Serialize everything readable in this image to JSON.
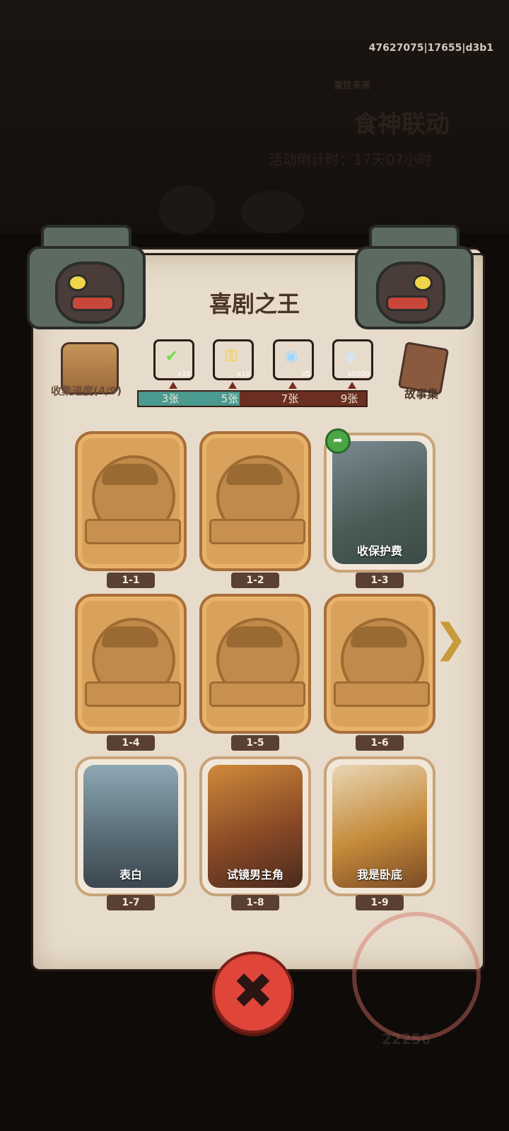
{
  "build_id": "47627075|17655|d3b1",
  "background": {
    "event_subtitle": "魔性来袭",
    "event_title": "食神联动",
    "countdown": "活动倒计时：17天07小时",
    "currency_amount": "22256"
  },
  "panel": {
    "title": "喜剧之王",
    "collect_progress": "收集进度(4/9)",
    "story_label": "故事集",
    "progress": {
      "collected": 4,
      "max": 9
    },
    "rewards": [
      {
        "icon": "checkmark-ticket-icon",
        "qty": "x10",
        "threshold": "3张",
        "color": "#3d86c7"
      },
      {
        "icon": "golden-key-icon",
        "qty": "x10",
        "threshold": "5张",
        "color": "#d7843a"
      },
      {
        "icon": "rainbow-orb-icon",
        "qty": "x5",
        "threshold": "7张",
        "color": "#c73d6a"
      },
      {
        "icon": "crystal-gem-icon",
        "qty": "x5000",
        "threshold": "9张",
        "color": "#8a4ac0"
      }
    ],
    "cards": [
      {
        "id": "1-1",
        "state": "locked",
        "caption": ""
      },
      {
        "id": "1-2",
        "state": "locked",
        "caption": ""
      },
      {
        "id": "1-3",
        "state": "open",
        "caption": "收保护费",
        "share": true
      },
      {
        "id": "1-4",
        "state": "locked",
        "caption": ""
      },
      {
        "id": "1-5",
        "state": "locked",
        "caption": ""
      },
      {
        "id": "1-6",
        "state": "locked",
        "caption": ""
      },
      {
        "id": "1-7",
        "state": "open",
        "caption": "表白"
      },
      {
        "id": "1-8",
        "state": "open",
        "caption": "试镜男主角"
      },
      {
        "id": "1-9",
        "state": "open",
        "caption": "我是卧底"
      }
    ]
  }
}
